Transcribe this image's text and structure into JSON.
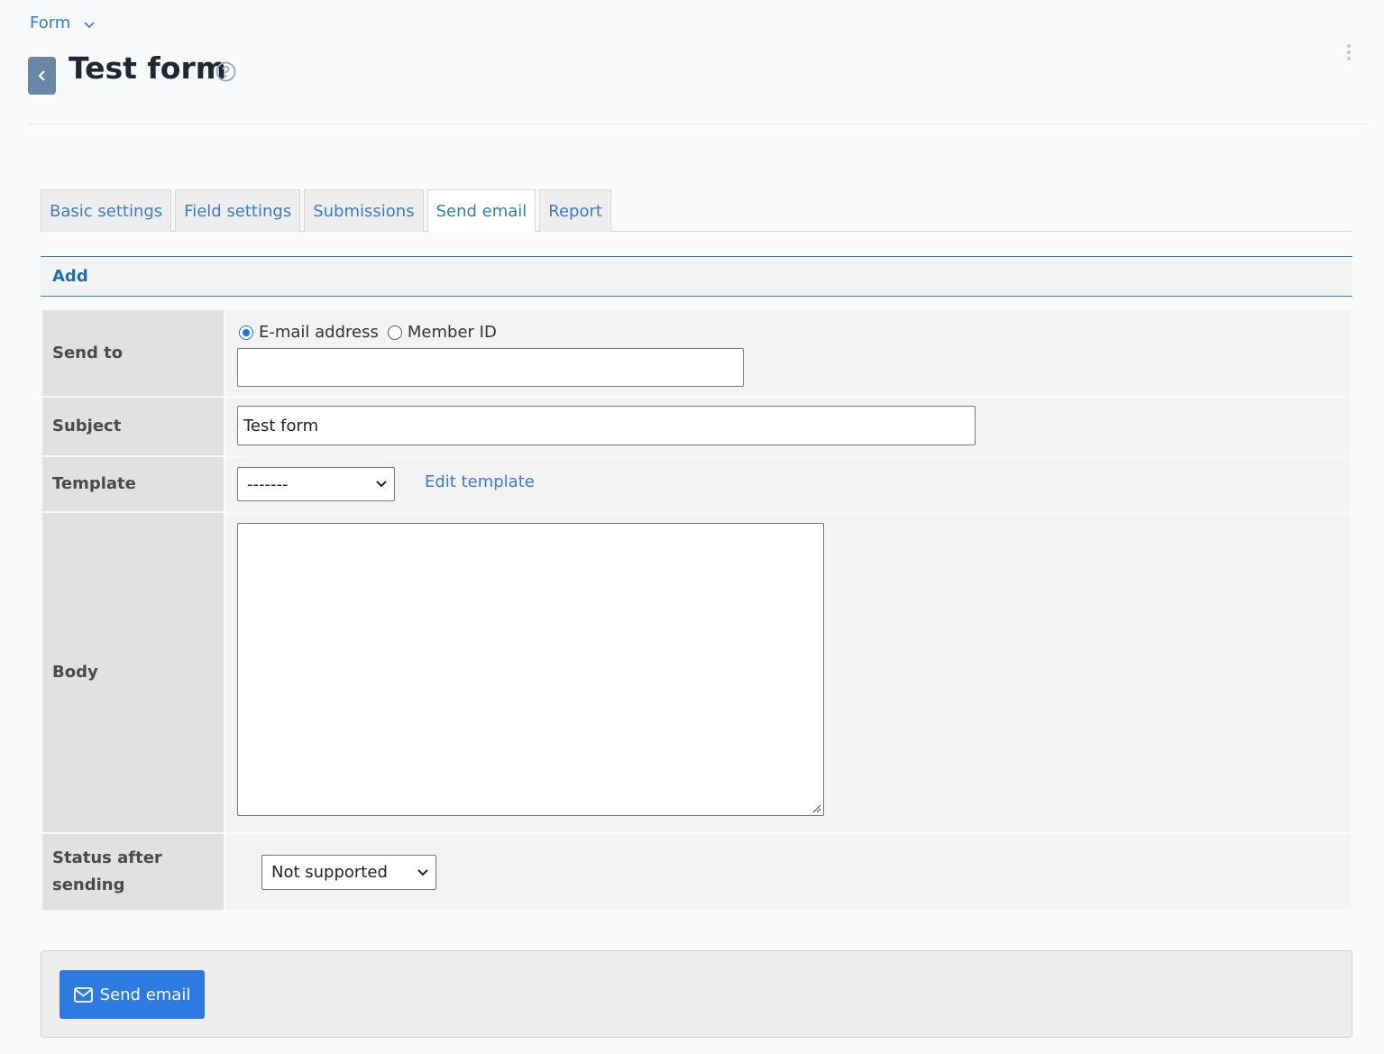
{
  "breadcrumb": {
    "label": "Form"
  },
  "header": {
    "title": "Test form"
  },
  "tabs": [
    {
      "label": "Basic settings"
    },
    {
      "label": "Field settings"
    },
    {
      "label": "Submissions"
    },
    {
      "label": "Send email",
      "active": true
    },
    {
      "label": "Report"
    }
  ],
  "section": {
    "add_label": "Add"
  },
  "form": {
    "send_to": {
      "label": "Send to",
      "options": [
        {
          "label": "E-mail address",
          "checked": true
        },
        {
          "label": "Member ID",
          "checked": false
        }
      ],
      "value": ""
    },
    "subject": {
      "label": "Subject",
      "value": "Test form"
    },
    "template": {
      "label": "Template",
      "selected": "-------",
      "edit_link": "Edit template"
    },
    "body": {
      "label": "Body",
      "value": ""
    },
    "status": {
      "label": "Status after sending",
      "selected": "Not supported"
    }
  },
  "footer": {
    "send_button": "Send email"
  },
  "colors": {
    "accent": "#2d7be0",
    "link": "#3a7cc6",
    "back_button": "#6a87a8"
  },
  "icons": [
    "chevron-down-icon",
    "chevron-left-icon",
    "help-icon",
    "kebab-menu-icon",
    "envelope-icon"
  ]
}
